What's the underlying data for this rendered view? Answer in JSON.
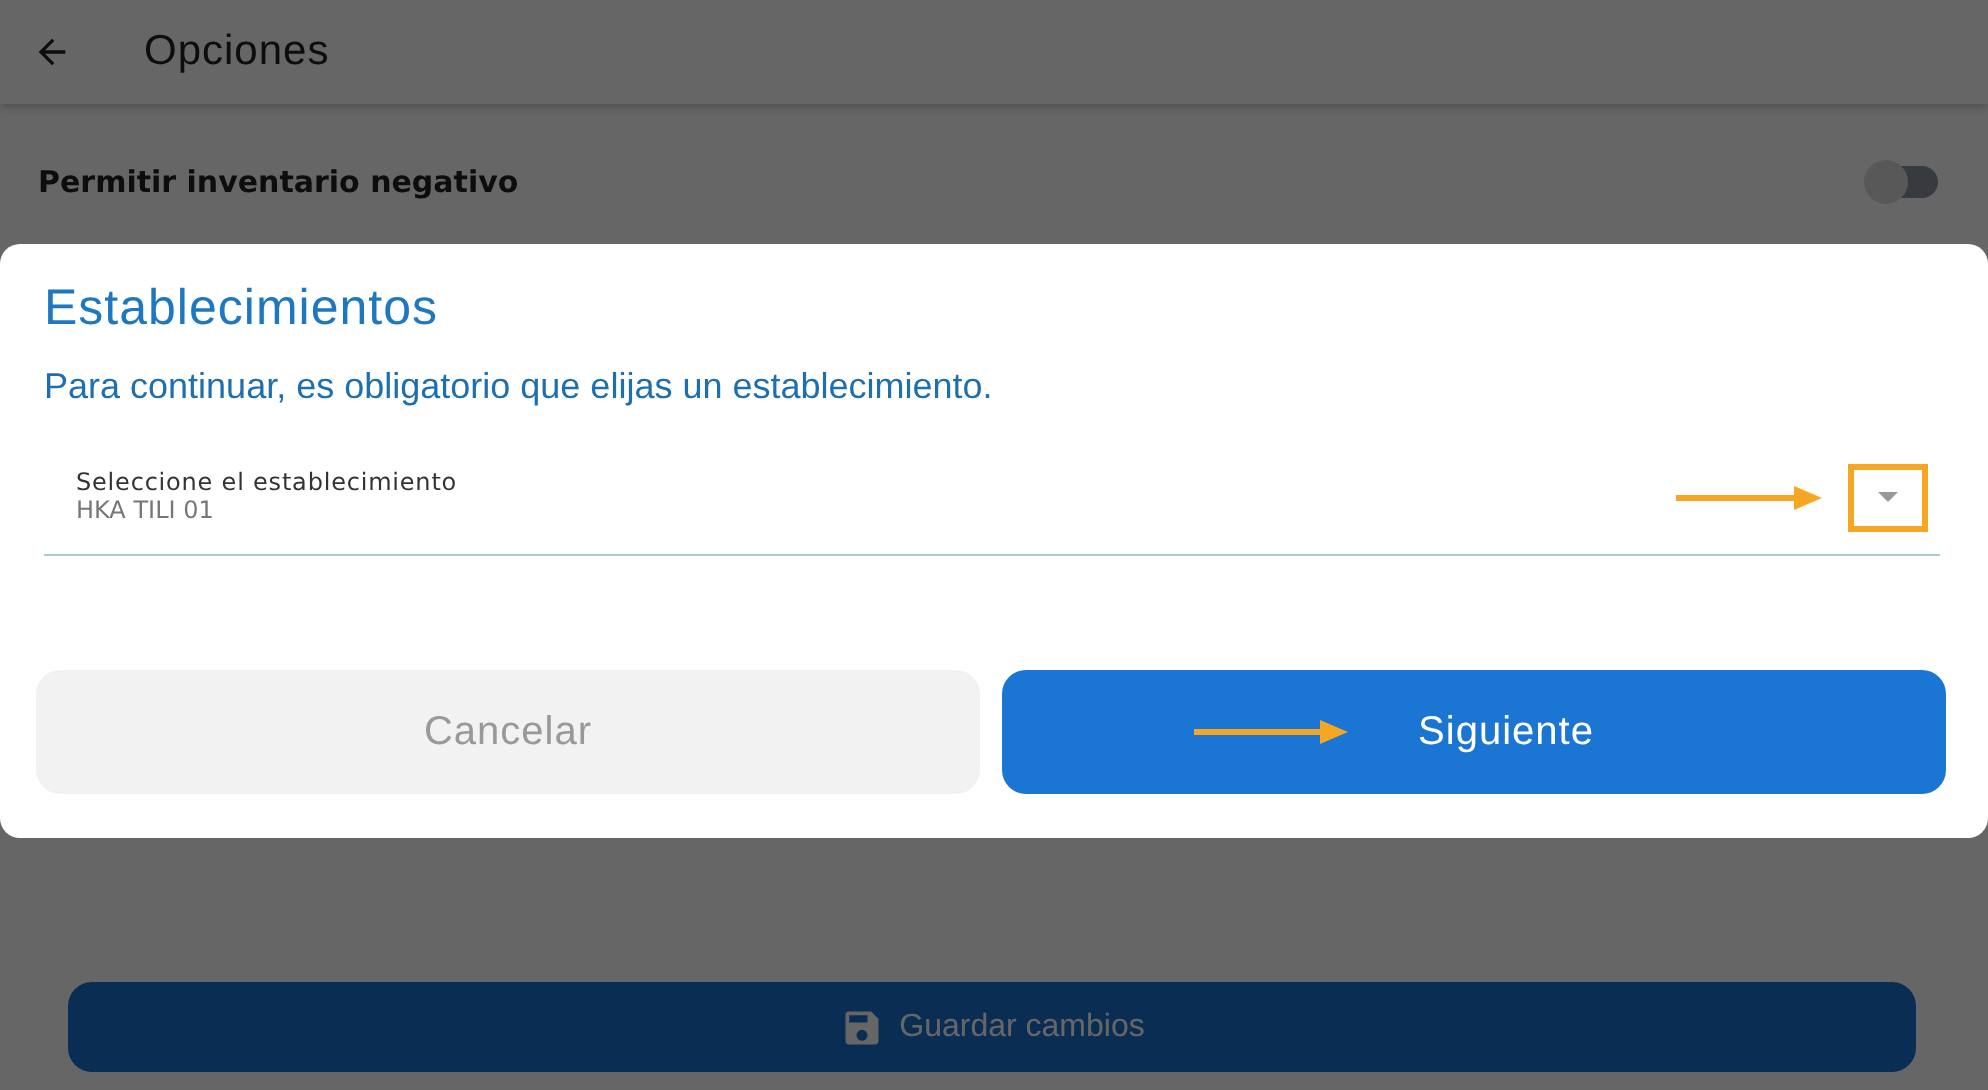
{
  "header": {
    "title": "Opciones"
  },
  "settings": [
    {
      "label": "Permitir inventario negativo",
      "on": false
    }
  ],
  "save_button": {
    "label": "Guardar cambios"
  },
  "dialog": {
    "title": "Establecimientos",
    "message": "Para continuar, es obligatorio que elijas un establecimiento.",
    "select": {
      "label": "Seleccione el establecimiento",
      "value": "HKA TILI 01"
    },
    "buttons": [
      {
        "label": "Cancelar",
        "kind": "secondary"
      },
      {
        "label": "Siguiente",
        "kind": "primary"
      }
    ]
  }
}
